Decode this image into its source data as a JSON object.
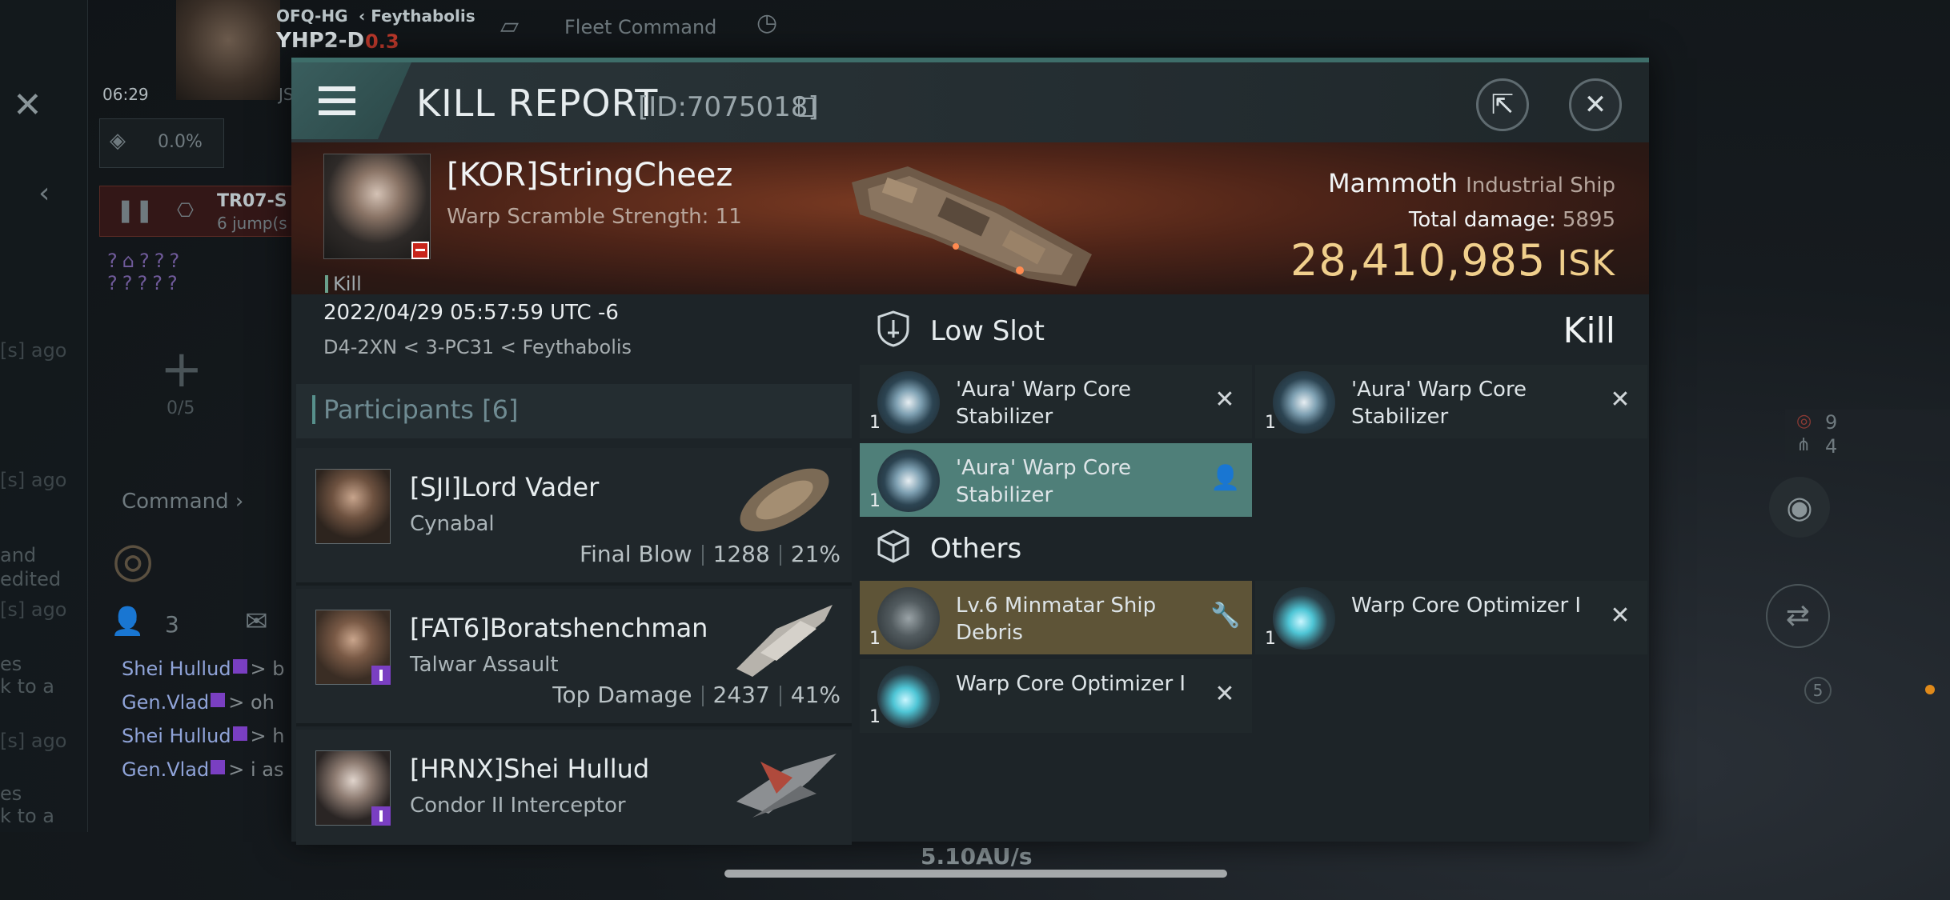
{
  "background": {
    "location_corp": "OFQ-HG",
    "region": "Feythabolis",
    "system": "YHP2-D",
    "security": "0.3",
    "tab_fleet": "Fleet Command",
    "clock": "06:29",
    "js_label": "JS",
    "cargo_pct": "0.0%",
    "route_system": "TR07-S",
    "route_jumps": "6 jump(s",
    "ago_text": "[s] ago",
    "counter": "0/5",
    "command_label": "Command",
    "members": "3",
    "side_lines": [
      "and",
      "edited",
      "es",
      "k to a",
      "es",
      "k to a"
    ],
    "chat": [
      {
        "name": "Shei Hullud",
        "msg": "> b"
      },
      {
        "name": "Gen.Vlad",
        "msg": "> oh"
      },
      {
        "name": "Shei Hullud",
        "msg": "> h"
      },
      {
        "name": "Gen.Vlad",
        "msg": "> i as"
      }
    ],
    "right_count_1": "9",
    "right_count_2": "4",
    "drone_badge": "5",
    "speed": "5.10AU/s"
  },
  "modal": {
    "title": "KILL REPORT",
    "id_text": "[ID:7075018]",
    "share_icon": "share-icon",
    "close_icon": "close-icon"
  },
  "victim": {
    "name": "[KOR]StringCheez",
    "scramble": "Warp Scramble Strength: 11",
    "kill_tag": "Kill",
    "datetime": "2022/04/29 05:57:59 UTC -6",
    "location": "D4-2XN < 3-PC31 < Feythabolis",
    "ship": "Mammoth",
    "ship_class": "Industrial Ship",
    "total_damage_label": "Total damage:",
    "total_damage": "5895",
    "isk_value": "28,410,985",
    "isk_unit": "ISK",
    "result": "Kill"
  },
  "participants": {
    "title": "Participants",
    "count": "[6]",
    "rows": [
      {
        "name": "[SJI]Lord Vader",
        "ship": "Cynabal",
        "role": "Final Blow",
        "damage": "1288",
        "pct": "21%"
      },
      {
        "name": "[FAT6]Boratshenchman",
        "ship": "Talwar Assault",
        "role": "Top Damage",
        "damage": "2437",
        "pct": "41%"
      },
      {
        "name": "[HRNX]Shei Hullud",
        "ship": "Condor II Interceptor",
        "role": "",
        "damage": "",
        "pct": ""
      }
    ]
  },
  "items": {
    "low_slot_title": "Low Slot",
    "others_title": "Others",
    "low_slot": [
      {
        "name": "'Aura' Warp Core Stabilizer",
        "qty": "1",
        "state": "destroyed"
      },
      {
        "name": "'Aura' Warp Core Stabilizer",
        "qty": "1",
        "state": "destroyed"
      },
      {
        "name": "'Aura' Warp Core Stabilizer",
        "qty": "1",
        "state": "dropped"
      }
    ],
    "others": [
      {
        "name": "Lv.6 Minmatar Ship Debris",
        "qty": "1",
        "state": "salvage"
      },
      {
        "name": "Warp Core Optimizer I",
        "qty": "1",
        "state": "destroyed"
      },
      {
        "name": "Warp Core Optimizer I",
        "qty": "1",
        "state": "destroyed"
      }
    ]
  },
  "colors": {
    "accent": "#4f7f79",
    "isk": "#f0cf8c",
    "security_red": "#c23a2c",
    "salvage": "#5e5437"
  }
}
